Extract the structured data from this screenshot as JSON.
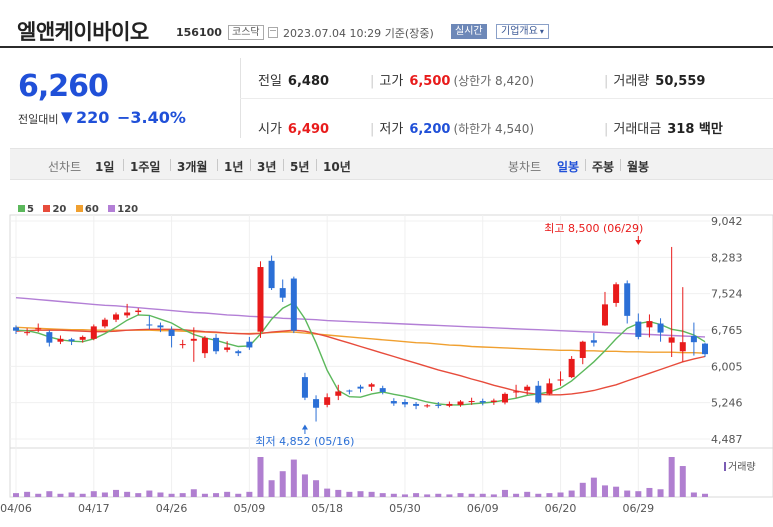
{
  "header": {
    "name": "엘앤케이바이오",
    "code": "156100",
    "market": "코스닥",
    "datetime": "2023.07.04 10:29",
    "basis": "기준(장중)",
    "realtime": "실시간",
    "overview": "기업개요",
    "overview_caret": "▾"
  },
  "price": {
    "current": "6,260",
    "compare_label": "전일대비",
    "direction_symbol": "▼",
    "change": "220",
    "change_rate": "−3.40%"
  },
  "stats": {
    "prev_label": "전일",
    "prev": "6,480",
    "high_label": "고가",
    "high": "6,500",
    "upper_limit_label": "(상한가 8,420)",
    "volume_label": "거래량",
    "volume": "50,559",
    "open_label": "시가",
    "open": "6,490",
    "low_label": "저가",
    "low": "6,200",
    "lower_limit_label": "(하한가 4,540)",
    "amount_label": "거래대금",
    "amount": "318 백만",
    "separator": "|"
  },
  "periods": {
    "line_label": "선차트",
    "line_items": [
      "1일",
      "1주일",
      "3개월",
      "1년",
      "3년",
      "5년",
      "10년"
    ],
    "candle_label": "봉차트",
    "candle_items": [
      "일봉",
      "주봉",
      "월봉"
    ],
    "active_candle": "일봉"
  },
  "colors": {
    "up": "#e81b1b",
    "down": "#2b6fd6",
    "ma5": "#5cb85c",
    "ma20": "#e74c3c",
    "ma60": "#f0a030",
    "ma120": "#b37fd6",
    "volume": "#b07fd0"
  },
  "chart_data": {
    "type": "candlestick",
    "legend": [
      {
        "name": "5",
        "color": "#5cb85c"
      },
      {
        "name": "20",
        "color": "#e74c3c"
      },
      {
        "name": "60",
        "color": "#f0a030"
      },
      {
        "name": "120",
        "color": "#b37fd6"
      }
    ],
    "volume_label": "거래량",
    "y_ticks": [
      9042,
      8283,
      7524,
      6765,
      6005,
      5246,
      4487
    ],
    "y_tick_labels": [
      "9,042",
      "8,283",
      "7,524",
      "6,765",
      "6,005",
      "5,246",
      "4,487"
    ],
    "ylim": [
      4487,
      9042
    ],
    "x_labels": [
      "04/06",
      "04/17",
      "04/26",
      "05/09",
      "05/18",
      "05/30",
      "06/09",
      "06/20",
      "06/29"
    ],
    "x_label_index": [
      0,
      7,
      14,
      21,
      28,
      35,
      42,
      49,
      56
    ],
    "annotations": {
      "high": {
        "text": "최고 8,500 (06/29)",
        "index": 56,
        "value": 8500
      },
      "low": {
        "text": "최저 4,852 (05/16)",
        "index": 26,
        "value": 4852
      }
    },
    "candles": [
      [
        6820,
        6860,
        6750,
        6680
      ],
      [
        6700,
        6800,
        6720,
        6650
      ],
      [
        6780,
        6900,
        6800,
        6720
      ],
      [
        6720,
        6760,
        6500,
        6420
      ],
      [
        6520,
        6650,
        6580,
        6470
      ],
      [
        6570,
        6600,
        6530,
        6450
      ],
      [
        6560,
        6650,
        6620,
        6500
      ],
      [
        6580,
        6880,
        6840,
        6550
      ],
      [
        6840,
        7020,
        6980,
        6800
      ],
      [
        6980,
        7130,
        7090,
        6930
      ],
      [
        7070,
        7310,
        7130,
        7020
      ],
      [
        7140,
        7220,
        7170,
        7080
      ],
      [
        6880,
        7070,
        6860,
        6780
      ],
      [
        6860,
        6920,
        6820,
        6720
      ],
      [
        6770,
        6840,
        6640,
        6400
      ],
      [
        6460,
        6560,
        6470,
        6380
      ],
      [
        6540,
        6820,
        6580,
        6100
      ],
      [
        6280,
        6640,
        6600,
        6180
      ],
      [
        6600,
        6680,
        6320,
        6260
      ],
      [
        6350,
        6530,
        6400,
        6300
      ],
      [
        6320,
        6350,
        6280,
        6220
      ],
      [
        6520,
        6620,
        6400,
        6350
      ],
      [
        6730,
        8200,
        8080,
        6600
      ],
      [
        8210,
        8320,
        7640,
        7600
      ],
      [
        7640,
        7820,
        7440,
        7350
      ],
      [
        7840,
        7880,
        6750,
        6700
      ],
      [
        5780,
        5870,
        5350,
        5300
      ],
      [
        5320,
        5400,
        5140,
        4852
      ],
      [
        5200,
        5440,
        5360,
        5150
      ],
      [
        5390,
        5620,
        5480,
        5300
      ],
      [
        5500,
        5520,
        5490,
        5420
      ],
      [
        5580,
        5620,
        5540,
        5460
      ],
      [
        5580,
        5660,
        5630,
        5490
      ],
      [
        5550,
        5600,
        5470,
        5420
      ],
      [
        5280,
        5340,
        5230,
        5180
      ],
      [
        5260,
        5320,
        5210,
        5150
      ],
      [
        5220,
        5260,
        5180,
        5110
      ],
      [
        5180,
        5220,
        5190,
        5140
      ],
      [
        5200,
        5260,
        5180,
        5130
      ],
      [
        5180,
        5270,
        5220,
        5150
      ],
      [
        5200,
        5300,
        5270,
        5160
      ],
      [
        5260,
        5350,
        5280,
        5200
      ],
      [
        5280,
        5330,
        5250,
        5190
      ],
      [
        5260,
        5330,
        5290,
        5200
      ],
      [
        5250,
        5460,
        5430,
        5210
      ],
      [
        5470,
        5620,
        5480,
        5350
      ],
      [
        5500,
        5620,
        5580,
        5410
      ],
      [
        5600,
        5700,
        5250,
        5230
      ],
      [
        5430,
        5750,
        5650,
        5400
      ],
      [
        5720,
        5900,
        5730,
        5600
      ],
      [
        5780,
        6220,
        6160,
        5760
      ],
      [
        6180,
        6540,
        6520,
        6050
      ],
      [
        6550,
        6700,
        6500,
        6420
      ],
      [
        6860,
        7560,
        7300,
        6850
      ],
      [
        7330,
        7760,
        7720,
        7250
      ],
      [
        7740,
        7800,
        7060,
        6900
      ],
      [
        6940,
        7110,
        6620,
        6570
      ],
      [
        6820,
        7090,
        6950,
        6610
      ],
      [
        6900,
        7010,
        6710,
        6520
      ],
      [
        6500,
        8500,
        6610,
        6200
      ],
      [
        6320,
        7660,
        6510,
        6100
      ],
      [
        6640,
        6920,
        6510,
        6230
      ],
      [
        6480,
        6500,
        6260,
        6200
      ]
    ],
    "ma5": [
      6760,
      6750,
      6700,
      6620,
      6560,
      6530,
      6520,
      6580,
      6690,
      6820,
      6970,
      7080,
      7070,
      6990,
      6910,
      6780,
      6670,
      6600,
      6550,
      6480,
      6420,
      6430,
      6680,
      6990,
      7220,
      7340,
      7000,
      6500,
      5920,
      5500,
      5370,
      5360,
      5430,
      5470,
      5420,
      5380,
      5320,
      5260,
      5220,
      5200,
      5200,
      5220,
      5240,
      5260,
      5300,
      5340,
      5400,
      5430,
      5470,
      5550,
      5700,
      5900,
      6100,
      6330,
      6580,
      6800,
      6900,
      6940,
      6880,
      6780,
      6740,
      6660,
      6520
    ],
    "ma20": [
      6740,
      6750,
      6760,
      6760,
      6760,
      6750,
      6740,
      6730,
      6730,
      6740,
      6760,
      6770,
      6780,
      6780,
      6780,
      6770,
      6750,
      6730,
      6720,
      6700,
      6690,
      6680,
      6690,
      6720,
      6740,
      6760,
      6740,
      6690,
      6630,
      6560,
      6490,
      6420,
      6350,
      6280,
      6210,
      6140,
      6070,
      6000,
      5930,
      5870,
      5810,
      5740,
      5680,
      5610,
      5550,
      5490,
      5450,
      5420,
      5410,
      5410,
      5430,
      5460,
      5500,
      5560,
      5620,
      5700,
      5780,
      5860,
      5940,
      6020,
      6100,
      6160,
      6210
    ],
    "ma60": [
      6820,
      6810,
      6800,
      6790,
      6780,
      6770,
      6770,
      6760,
      6760,
      6760,
      6760,
      6760,
      6760,
      6750,
      6750,
      6740,
      6730,
      6720,
      6710,
      6700,
      6690,
      6690,
      6700,
      6710,
      6720,
      6720,
      6700,
      6680,
      6660,
      6640,
      6620,
      6600,
      6580,
      6560,
      6540,
      6520,
      6500,
      6490,
      6470,
      6450,
      6440,
      6420,
      6410,
      6400,
      6390,
      6380,
      6370,
      6360,
      6350,
      6340,
      6340,
      6330,
      6330,
      6320,
      6320,
      6310,
      6310,
      6300,
      6300,
      6300,
      6290,
      6290,
      6280
    ],
    "ma120": [
      7440,
      7420,
      7400,
      7380,
      7360,
      7340,
      7320,
      7300,
      7280,
      7270,
      7250,
      7230,
      7210,
      7190,
      7170,
      7150,
      7130,
      7120,
      7100,
      7080,
      7070,
      7050,
      7040,
      7030,
      7010,
      7000,
      6990,
      6980,
      6960,
      6950,
      6940,
      6930,
      6920,
      6910,
      6900,
      6890,
      6880,
      6870,
      6860,
      6850,
      6840,
      6830,
      6820,
      6810,
      6800,
      6790,
      6780,
      6770,
      6760,
      6750,
      6740,
      6730,
      6720,
      6710,
      6700,
      6690,
      6680,
      6670,
      6660,
      6650,
      6640,
      6630,
      6620
    ],
    "volume": [
      6,
      8,
      5,
      9,
      5,
      7,
      5,
      9,
      7,
      11,
      8,
      6,
      10,
      7,
      5,
      6,
      12,
      5,
      6,
      8,
      5,
      8,
      62,
      26,
      40,
      58,
      35,
      26,
      13,
      11,
      8,
      9,
      8,
      6,
      5,
      4,
      6,
      4,
      5,
      4,
      6,
      5,
      5,
      4,
      11,
      5,
      8,
      5,
      6,
      7,
      10,
      22,
      30,
      18,
      16,
      10,
      9,
      14,
      12,
      62,
      48,
      7,
      5
    ]
  }
}
